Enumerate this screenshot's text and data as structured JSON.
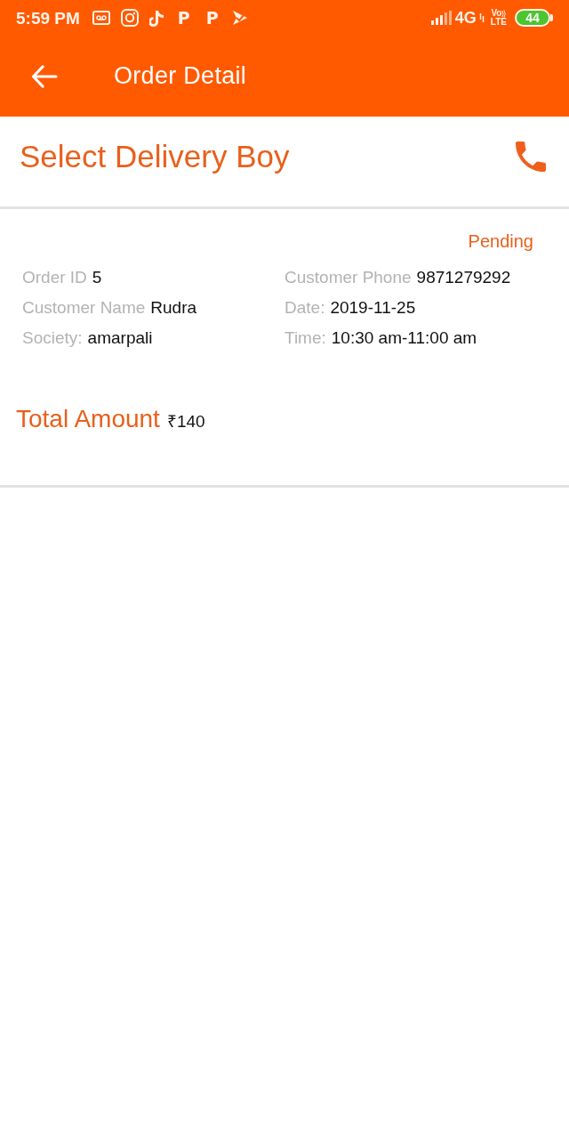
{
  "status_bar": {
    "time": "5:59 PM",
    "notifications": [
      {
        "kind": "tape"
      },
      {
        "kind": "camera"
      },
      {
        "kind": "note"
      },
      {
        "kind": "letter",
        "glyph": "P"
      },
      {
        "kind": "letter",
        "glyph": "P"
      },
      {
        "kind": "flag"
      }
    ],
    "network": "4G",
    "volte": {
      "top": "Vo",
      "bottom": "LTE"
    },
    "battery": "44"
  },
  "app_bar": {
    "title": "Order Detail"
  },
  "delivery": {
    "title": "Select Delivery Boy"
  },
  "order": {
    "status": "Pending",
    "left_column": [
      {
        "label": "Order ID",
        "value": "5"
      },
      {
        "label": "Customer Name",
        "value": "Rudra"
      },
      {
        "label": "Society:",
        "value": "amarpali"
      }
    ],
    "right_column": [
      {
        "label": "Customer Phone",
        "value": "9871279292"
      },
      {
        "label": "Date:",
        "value": "2019-11-25"
      },
      {
        "label": "Time:",
        "value": "10:30 am-11:00 am"
      }
    ],
    "total": {
      "label": "Total Amount",
      "value": "₹140"
    }
  }
}
